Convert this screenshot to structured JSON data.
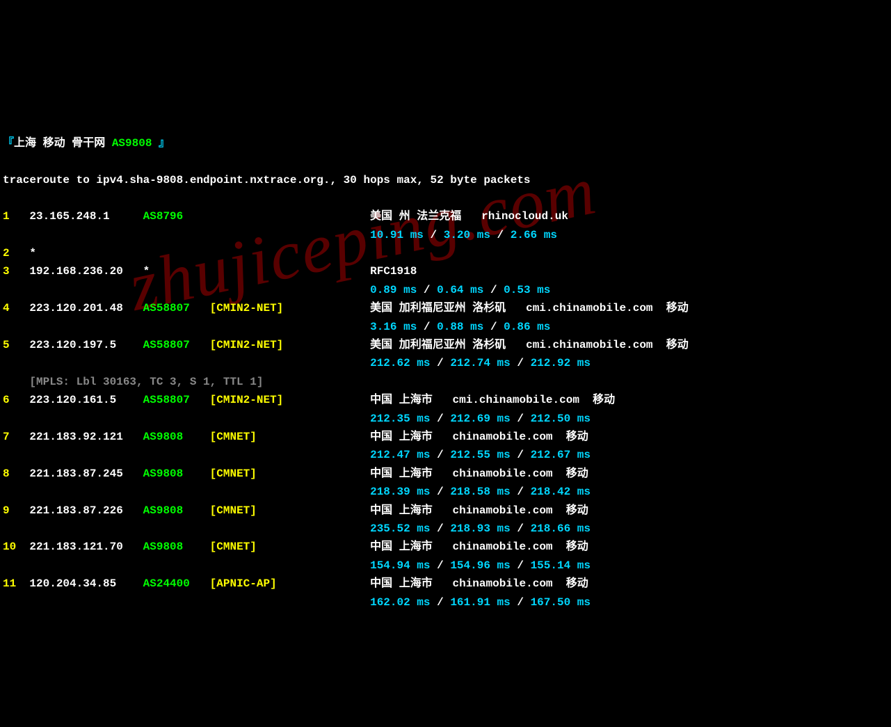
{
  "watermark": "zhujiceping.com",
  "header": {
    "prefix": "『",
    "title": "上海 移动 骨干网 ",
    "asn": "AS9808",
    "suffix": " 』"
  },
  "traceroute_line": "traceroute to ipv4.sha-9808.endpoint.nxtrace.org., 30 hops max, 52 byte packets",
  "hops": [
    {
      "num": "1",
      "ip": "23.165.248.1",
      "asn": "AS8796",
      "net": "",
      "location": "美国 州 法兰克福   rhinocloud.uk",
      "latency": [
        "10.91 ms",
        "3.20 ms",
        "2.66 ms"
      ]
    },
    {
      "num": "2",
      "ip": "*",
      "asn": "",
      "net": "",
      "location": "",
      "latency": []
    },
    {
      "num": "3",
      "ip": "192.168.236.20",
      "asn": "*",
      "net": "",
      "location": "RFC1918",
      "latency": [
        "0.89 ms",
        "0.64 ms",
        "0.53 ms"
      ]
    },
    {
      "num": "4",
      "ip": "223.120.201.48",
      "asn": "AS58807",
      "net": "[CMIN2-NET]",
      "location": "美国 加利福尼亚州 洛杉矶   cmi.chinamobile.com  移动",
      "latency": [
        "3.16 ms",
        "0.88 ms",
        "0.86 ms"
      ]
    },
    {
      "num": "5",
      "ip": "223.120.197.5",
      "asn": "AS58807",
      "net": "[CMIN2-NET]",
      "location": "美国 加利福尼亚州 洛杉矶   cmi.chinamobile.com  移动",
      "latency": [
        "212.62 ms",
        "212.74 ms",
        "212.92 ms"
      ],
      "mpls": "[MPLS: Lbl 30163, TC 3, S 1, TTL 1]"
    },
    {
      "num": "6",
      "ip": "223.120.161.5",
      "asn": "AS58807",
      "net": "[CMIN2-NET]",
      "location": "中国 上海市   cmi.chinamobile.com  移动",
      "latency": [
        "212.35 ms",
        "212.69 ms",
        "212.50 ms"
      ]
    },
    {
      "num": "7",
      "ip": "221.183.92.121",
      "asn": "AS9808",
      "net": "[CMNET]",
      "location": "中国 上海市   chinamobile.com  移动",
      "latency": [
        "212.47 ms",
        "212.55 ms",
        "212.67 ms"
      ]
    },
    {
      "num": "8",
      "ip": "221.183.87.245",
      "asn": "AS9808",
      "net": "[CMNET]",
      "location": "中国 上海市   chinamobile.com  移动",
      "latency": [
        "218.39 ms",
        "218.58 ms",
        "218.42 ms"
      ]
    },
    {
      "num": "9",
      "ip": "221.183.87.226",
      "asn": "AS9808",
      "net": "[CMNET]",
      "location": "中国 上海市   chinamobile.com  移动",
      "latency": [
        "235.52 ms",
        "218.93 ms",
        "218.66 ms"
      ]
    },
    {
      "num": "10",
      "ip": "221.183.121.70",
      "asn": "AS9808",
      "net": "[CMNET]",
      "location": "中国 上海市   chinamobile.com  移动",
      "latency": [
        "154.94 ms",
        "154.96 ms",
        "155.14 ms"
      ]
    },
    {
      "num": "11",
      "ip": "120.204.34.85",
      "asn": "AS24400",
      "net": "[APNIC-AP]",
      "location": "中国 上海市   chinamobile.com  移动",
      "latency": [
        "162.02 ms",
        "161.91 ms",
        "167.50 ms"
      ]
    }
  ]
}
